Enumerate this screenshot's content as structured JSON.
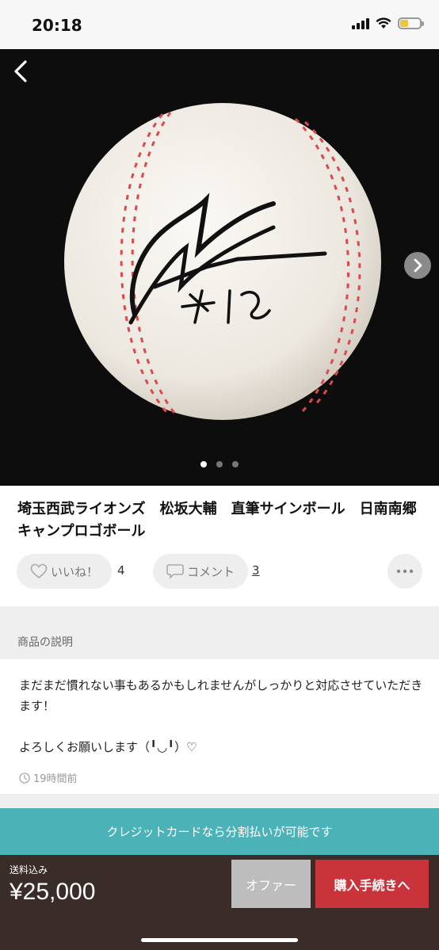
{
  "status_bar": {
    "time": "20:18",
    "battery_level": 0.4,
    "battery_color": "#f0c33c"
  },
  "photo": {
    "image_count": 3,
    "active_index": 0
  },
  "item": {
    "title": "埼玉西武ライオンズ　松坂大輔　直筆サインボール　日南南郷キャンプロゴボール"
  },
  "actions": {
    "like_label": "いいね！",
    "like_count": "4",
    "comment_label": "コメント",
    "comment_count": "3"
  },
  "description": {
    "section_label": "商品の説明",
    "text": "まだまだ慣れない事もあるかもしれませんがしっかりと対応させていただきます！\n\nよろしくお願いします（╹◡╹）♡",
    "posted": "19時間前"
  },
  "credit_banner": "クレジットカードなら分割払いが可能です",
  "purchase": {
    "shipping_label": "送料込み",
    "price": "¥25,000",
    "offer_button": "オファー",
    "buy_button": "購入手続きへ"
  },
  "colors": {
    "accent_red": "#c8343a",
    "teal_banner": "#4bb2b8",
    "bottom_bar": "#3a2c28"
  }
}
